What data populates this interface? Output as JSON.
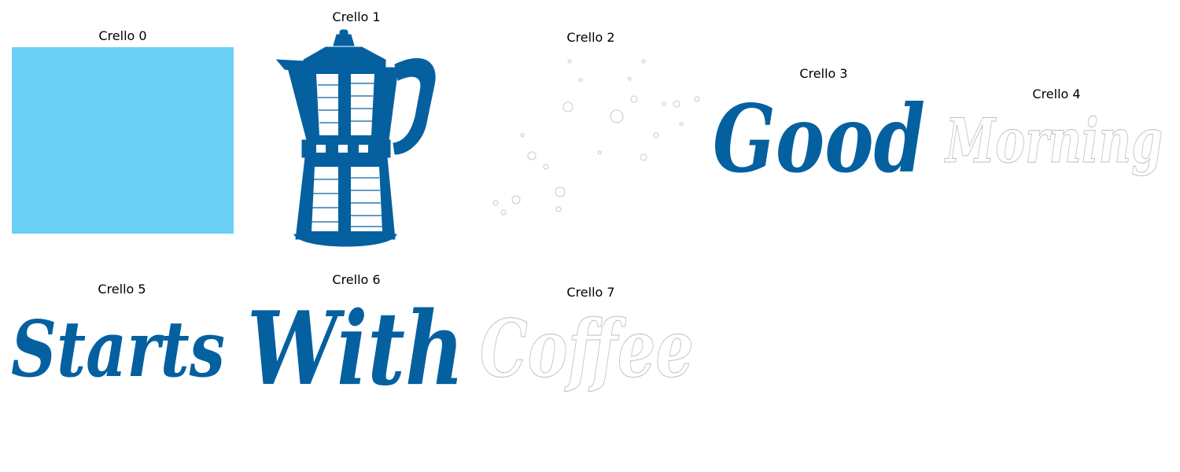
{
  "colors": {
    "ink": "#0560a0",
    "sky": "#6bcff6",
    "outline": "#bdbdbd"
  },
  "cells": [
    {
      "caption": "Crello 0"
    },
    {
      "caption": "Crello 1",
      "icon": "moka-pot-icon"
    },
    {
      "caption": "Crello 2",
      "icon": "bubbles-icon"
    },
    {
      "caption": "Crello 3",
      "word": "Good"
    },
    {
      "caption": "Crello 4",
      "word": "Morning"
    },
    {
      "caption": "Crello 5",
      "word": "Starts"
    },
    {
      "caption": "Crello 6",
      "word": "With"
    },
    {
      "caption": "Crello 7",
      "word": "Coffee"
    }
  ]
}
